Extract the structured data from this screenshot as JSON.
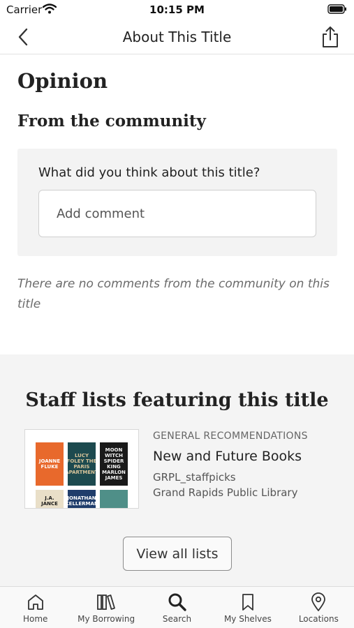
{
  "status_bar": {
    "carrier": "Carrier",
    "time": "10:15 PM"
  },
  "nav": {
    "title": "About This Title",
    "back_icon": "chevron-left-icon",
    "share_icon": "share-icon"
  },
  "opinion": {
    "heading": "Opinion",
    "community_heading": "From the community",
    "question": "What did you think about this title?",
    "input_placeholder": "Add comment",
    "input_value": "",
    "empty_message": "There are no comments from the community on this title"
  },
  "staff_lists": {
    "heading": "Staff lists featuring this title",
    "items": [
      {
        "category": "GENERAL RECOMMENDATIONS",
        "title": "New and Future Books",
        "author": "GRPL_staffpicks",
        "library": "Grand Rapids Public Library",
        "covers": [
          {
            "text": "JOANNE FLUKE",
            "bg": "#e8692c",
            "fg": "#ffffff"
          },
          {
            "text": "LUCY FOLEY THE PARIS APARTMENT",
            "bg": "#1d4a4f",
            "fg": "#d8c49a"
          },
          {
            "text": "MOON WITCH SPIDER KING MARLON JAMES",
            "bg": "#1a1a1a",
            "fg": "#f2f2f2"
          },
          {
            "text": "J.A. JANCE",
            "bg": "#e9dfc8",
            "fg": "#1a1a1a"
          },
          {
            "text": "JONATHAN KELLERMAN",
            "bg": "#1f3d6b",
            "fg": "#ffffff"
          },
          {
            "text": "",
            "bg": "#4f8f88",
            "fg": "#ffffff"
          }
        ]
      }
    ],
    "view_all_label": "View all lists"
  },
  "tab_bar": {
    "items": [
      {
        "label": "Home",
        "icon": "home-icon"
      },
      {
        "label": "My Borrowing",
        "icon": "books-icon"
      },
      {
        "label": "Search",
        "icon": "search-icon"
      },
      {
        "label": "My Shelves",
        "icon": "bookmark-icon"
      },
      {
        "label": "Locations",
        "icon": "location-pin-icon"
      }
    ]
  },
  "colors": {
    "text": "#222222",
    "muted": "#6b6b6b",
    "section_bg": "#f4f4f4",
    "card_bg": "#f3f3f3"
  }
}
